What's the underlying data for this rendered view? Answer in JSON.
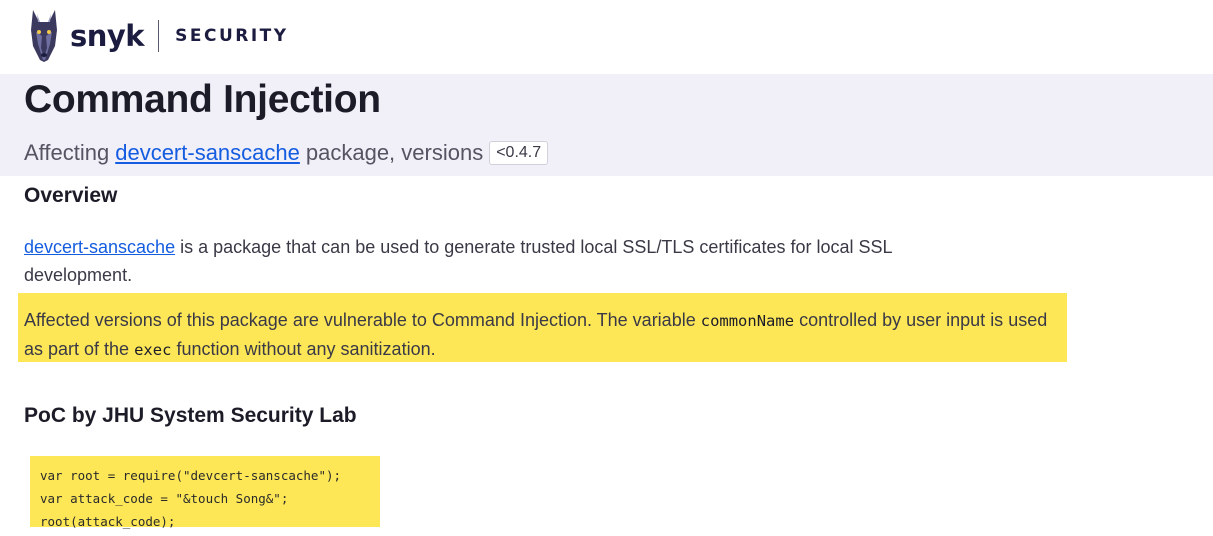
{
  "brand": {
    "name": "snyk",
    "section": "SECURITY",
    "logo_icon": "snyk-doberman-icon"
  },
  "hero": {
    "title": "Command Injection",
    "affecting_prefix": "Affecting",
    "package_link": "devcert-sanscache",
    "affecting_suffix": "package, versions",
    "version_range": "<0.4.7"
  },
  "overview": {
    "heading": "Overview",
    "package_link": "devcert-sanscache",
    "description": "is a package that can be used to generate trusted local SSL/TLS certificates for local SSL development.",
    "vuln_part1": "Affected versions of this package are vulnerable to Command Injection. The variable",
    "vuln_code1": "commonName",
    "vuln_part2": "controlled by user input is used as part of the",
    "vuln_code2": "exec",
    "vuln_part3": "function without any sanitization."
  },
  "poc": {
    "heading": "PoC by JHU System Security Lab",
    "code_lines": [
      "var root = require(\"devcert-sanscache\");",
      "var attack_code = \"&touch Song&\";",
      "root(attack_code);"
    ]
  },
  "colors": {
    "link": "#145ce0",
    "highlight": "#fde757",
    "hero_bg": "#f1eff7",
    "brand_dark": "#1c1c40"
  }
}
